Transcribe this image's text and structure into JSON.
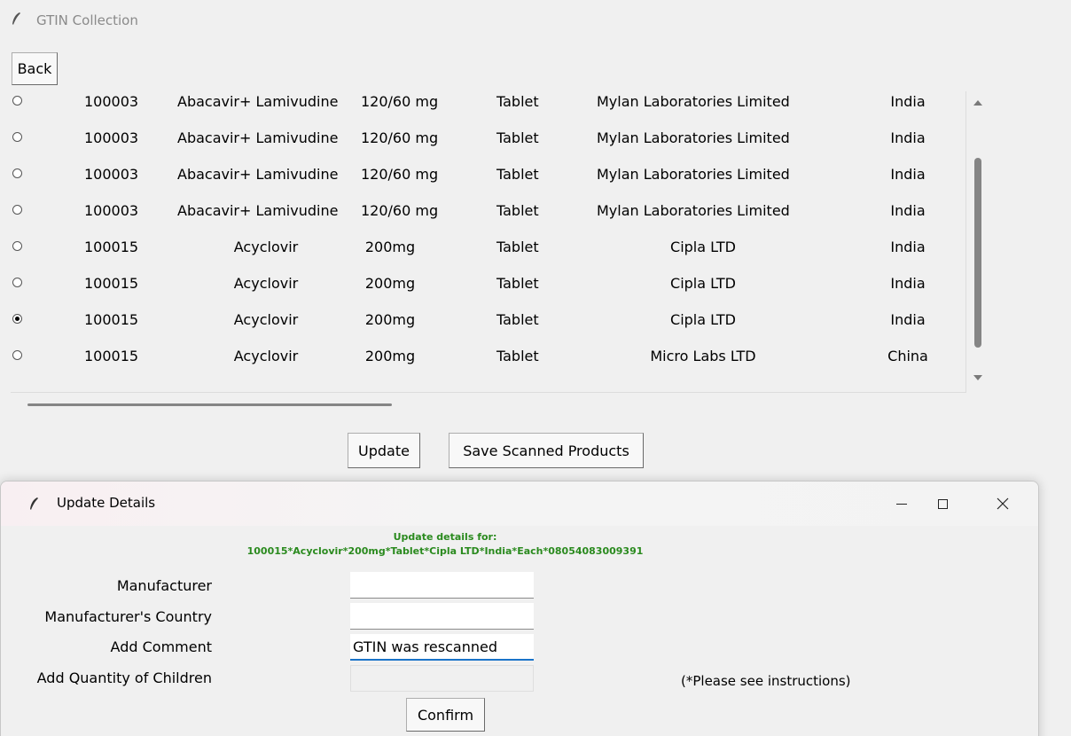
{
  "main_window": {
    "title": "GTIN Collection",
    "back_label": "Back",
    "update_label": "Update",
    "save_label": "Save Scanned Products"
  },
  "rows": [
    {
      "selected": false,
      "id": "100003",
      "name": "Abacavir+ Lamivudine",
      "strength": "120/60 mg",
      "form": "Tablet",
      "manufacturer": "Mylan Laboratories Limited",
      "country": "India"
    },
    {
      "selected": false,
      "id": "100003",
      "name": "Abacavir+ Lamivudine",
      "strength": "120/60 mg",
      "form": "Tablet",
      "manufacturer": "Mylan Laboratories Limited",
      "country": "India"
    },
    {
      "selected": false,
      "id": "100003",
      "name": "Abacavir+ Lamivudine",
      "strength": "120/60 mg",
      "form": "Tablet",
      "manufacturer": "Mylan Laboratories Limited",
      "country": "India"
    },
    {
      "selected": false,
      "id": "100003",
      "name": "Abacavir+ Lamivudine",
      "strength": "120/60 mg",
      "form": "Tablet",
      "manufacturer": "Mylan Laboratories Limited",
      "country": "India"
    },
    {
      "selected": false,
      "id": "100015",
      "name": "Acyclovir",
      "strength": "200mg",
      "form": "Tablet",
      "manufacturer": "Cipla LTD",
      "country": "India"
    },
    {
      "selected": false,
      "id": "100015",
      "name": "Acyclovir",
      "strength": "200mg",
      "form": "Tablet",
      "manufacturer": "Cipla LTD",
      "country": "India"
    },
    {
      "selected": true,
      "id": "100015",
      "name": "Acyclovir",
      "strength": "200mg",
      "form": "Tablet",
      "manufacturer": "Cipla LTD",
      "country": "India"
    },
    {
      "selected": false,
      "id": "100015",
      "name": "Acyclovir",
      "strength": "200mg",
      "form": "Tablet",
      "manufacturer": "Micro Labs LTD",
      "country": "China"
    }
  ],
  "dialog": {
    "title": "Update Details",
    "header_line1": "Update details for:",
    "header_line2": "100015*Acyclovir*200mg*Tablet*Cipla LTD*India*Each*08054083009391",
    "manufacturer_label": "Manufacturer",
    "manufacturer_value": "",
    "country_label": "Manufacturer's Country",
    "country_value": "",
    "comment_label": "Add Comment",
    "comment_value": "GTIN was rescanned",
    "children_label": "Add Quantity of Children",
    "children_value": "",
    "note": "(*Please see instructions)",
    "confirm_label": "Confirm"
  },
  "colors": {
    "header_text": "#2a8a1e",
    "focus_underline": "#1a73c9"
  }
}
